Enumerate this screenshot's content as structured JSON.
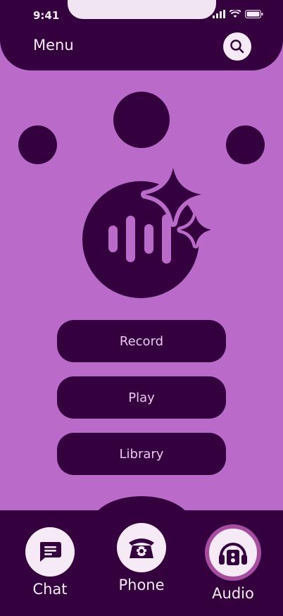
{
  "status": {
    "time": "9:41"
  },
  "header": {
    "title": "Menu"
  },
  "actions": [
    {
      "label": "Record"
    },
    {
      "label": "Play"
    },
    {
      "label": "Library"
    }
  ],
  "nav": {
    "chat": "Chat",
    "phone": "Phone",
    "audio": "Audio",
    "active": "Audio"
  },
  "colors": {
    "background": "#ba6ac8",
    "dark": "#34003d",
    "light": "#f6eaf7",
    "active_ring": "#a54ea0"
  }
}
